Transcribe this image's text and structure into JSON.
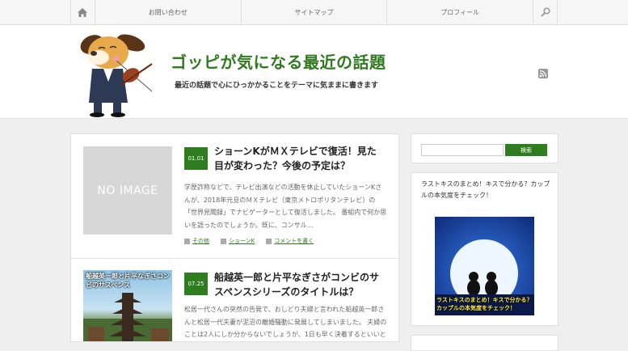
{
  "nav": {
    "items": [
      {
        "label": "お問い合わせ"
      },
      {
        "label": "サイトマップ"
      },
      {
        "label": "プロフィール"
      }
    ]
  },
  "header": {
    "title": "ゴッピが気になる最近の話題",
    "description": "最近の話題で心にひっかかることをテーマに気ままに書きます"
  },
  "posts": [
    {
      "date": "01.01",
      "title": "ショーンKがＭＸテレビで復活！見た目が変わった？今後の予定は？",
      "thumb_text": "NO IMAGE",
      "excerpt": "学歴詐称などで、テレビ出演などの活動を休止していたショーンKさんが、2018年元旦のＭＸテレビ（東京メトロポリタンテレビ）の「世界見聞録」でナビゲーターとして復活しました。 番組内で何か思いを語ったのでしょうか。既に、コンサル…",
      "category": "その他",
      "tag": "ショーンK",
      "comment": "コメントを書く"
    },
    {
      "date": "07.25",
      "title": "船越英一郎と片平なぎさがコンビのサスペンスシリーズのタイトルは？",
      "thumb_text": "船越英一郎と片平なぎさコンビのサスペンス",
      "excerpt": "松居一代さんの突然の告発で、おしどり夫婦と言われた船越英一郎さんと松居一代夫妻が泥沼の離婚騒動に発展してしまいました。 夫婦のことは2人にしか分からないでしょうが、1日も早く決着するといいと"
    }
  ],
  "sidebar": {
    "search_button": "検索",
    "widget_title": "ラストキスのまとめ！キスで分かる？カップルの本気度をチェック！",
    "widget_image_text": "ラストキスのまとめ！キスで分かる？カップルの本気度をチェック！"
  },
  "colors": {
    "accent": "#2e7d1e",
    "title": "#2f7a1f"
  }
}
